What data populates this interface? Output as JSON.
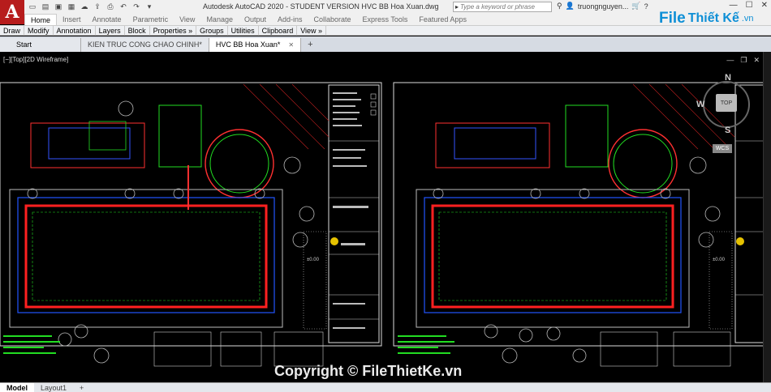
{
  "window": {
    "title": "Autodesk AutoCAD 2020 - STUDENT VERSION    HVC BB Hoa Xuan.dwg",
    "search_placeholder": "Type a keyword or phrase",
    "user": "truongnguyen...",
    "logo_letter": "A"
  },
  "ribbon": {
    "tabs": [
      {
        "label": "Home",
        "active": true
      },
      {
        "label": "Insert"
      },
      {
        "label": "Annotate"
      },
      {
        "label": "Parametric"
      },
      {
        "label": "View"
      },
      {
        "label": "Manage"
      },
      {
        "label": "Output"
      },
      {
        "label": "Add-ins"
      },
      {
        "label": "Collaborate"
      },
      {
        "label": "Express Tools"
      },
      {
        "label": "Featured Apps"
      }
    ],
    "panels": [
      "Draw",
      "Modify",
      "Annotation",
      "Layers",
      "Block",
      "Properties »",
      "Groups",
      "Utilities",
      "Clipboard",
      "View »"
    ]
  },
  "doc_tabs": {
    "start": "Start",
    "files": [
      {
        "label": "KIEN TRUC CONG CHAO CHINH*",
        "active": false
      },
      {
        "label": "HVC BB Hoa Xuan*",
        "active": true
      }
    ],
    "plus": "+"
  },
  "viewport": {
    "label": "[−][Top][2D Wireframe]"
  },
  "viewcube": {
    "north": "N",
    "west": "W",
    "south": "S",
    "top": "TOP",
    "wcs": "WCS"
  },
  "model_tabs": [
    {
      "label": "Model",
      "active": true
    },
    {
      "label": "Layout1"
    },
    {
      "label": "+"
    }
  ],
  "watermark": {
    "brand": "File",
    "brand_rest": "Thiết Kế",
    "domain": ".vn",
    "copyright": "Copyright © FileThietKe.vn"
  },
  "drawing_labels": {
    "level_left": "±0.00",
    "level_right": "±0.00"
  },
  "colors": {
    "accent": "#0e8fd6",
    "cad_bg": "#000000",
    "pool_red": "#ff2020",
    "green": "#22dd22",
    "blue": "#3355ff"
  }
}
